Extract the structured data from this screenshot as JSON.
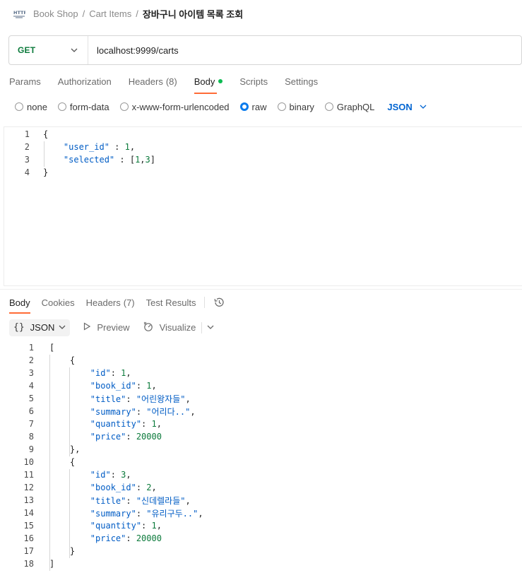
{
  "breadcrumb": {
    "icon": "http-icon",
    "items": [
      "Book Shop",
      "Cart Items"
    ],
    "current": "장바구니 아이템 목록 조회"
  },
  "request": {
    "method": "GET",
    "url": "localhost:9999/carts"
  },
  "request_tabs": [
    {
      "label": "Params",
      "active": false
    },
    {
      "label": "Authorization",
      "active": false
    },
    {
      "label": "Headers",
      "count": "(8)",
      "active": false
    },
    {
      "label": "Body",
      "active": true,
      "indicator": "green-dot"
    },
    {
      "label": "Scripts",
      "active": false
    },
    {
      "label": "Settings",
      "active": false
    }
  ],
  "body_types": [
    {
      "label": "none",
      "checked": false
    },
    {
      "label": "form-data",
      "checked": false
    },
    {
      "label": "x-www-form-urlencoded",
      "checked": false
    },
    {
      "label": "raw",
      "checked": true
    },
    {
      "label": "binary",
      "checked": false
    },
    {
      "label": "GraphQL",
      "checked": false
    }
  ],
  "body_format": "JSON",
  "request_body_lines": [
    "{",
    "    \"user_id\" : 1,",
    "    \"selected\" : [1,3]",
    "}"
  ],
  "response_tabs": [
    {
      "label": "Body",
      "active": true
    },
    {
      "label": "Cookies",
      "active": false
    },
    {
      "label": "Headers",
      "count": "(7)",
      "active": false
    },
    {
      "label": "Test Results",
      "active": false
    }
  ],
  "response_toolbar": {
    "format": "JSON",
    "format_icon": "{}",
    "preview": "Preview",
    "visualize": "Visualize"
  },
  "response_body_lines": [
    "[",
    "    {",
    "        \"id\": 1,",
    "        \"book_id\": 1,",
    "        \"title\": \"어린왕자들\",",
    "        \"summary\": \"어리다..\",",
    "        \"quantity\": 1,",
    "        \"price\": 20000",
    "    },",
    "    {",
    "        \"id\": 3,",
    "        \"book_id\": 2,",
    "        \"title\": \"신데렐라들\",",
    "        \"summary\": \"유리구두..\",",
    "        \"quantity\": 1,",
    "        \"price\": 20000",
    "    }",
    "]"
  ],
  "colors": {
    "method_get": "#0b7a3b",
    "active_tab_underline": "#ff6c37",
    "body_dot": "#0cbb52",
    "radio_checked": "#097bed",
    "json_select": "#0265d2",
    "json_key": "#005cc5",
    "json_number": "#0b7a3b"
  }
}
